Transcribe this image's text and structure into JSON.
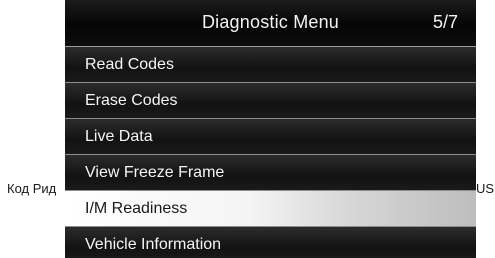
{
  "caption": {
    "left": "Код Рид",
    "right": "US"
  },
  "header": {
    "title": "Diagnostic Menu",
    "page": "5/7"
  },
  "menu": {
    "items": [
      {
        "label": "Read Codes"
      },
      {
        "label": "Erase Codes"
      },
      {
        "label": "Live Data"
      },
      {
        "label": "View Freeze Frame"
      },
      {
        "label": "I/M Readiness",
        "selected": true
      },
      {
        "label": "Vehicle Information"
      }
    ]
  },
  "colors": {
    "screen_background": "#0a0a0a",
    "header_text": "#f2f2f2",
    "menu_text": "#f5f5f5",
    "selected_background": "#ffffff",
    "selected_text": "#1a1a1a",
    "divider": "#8c8c8c"
  }
}
